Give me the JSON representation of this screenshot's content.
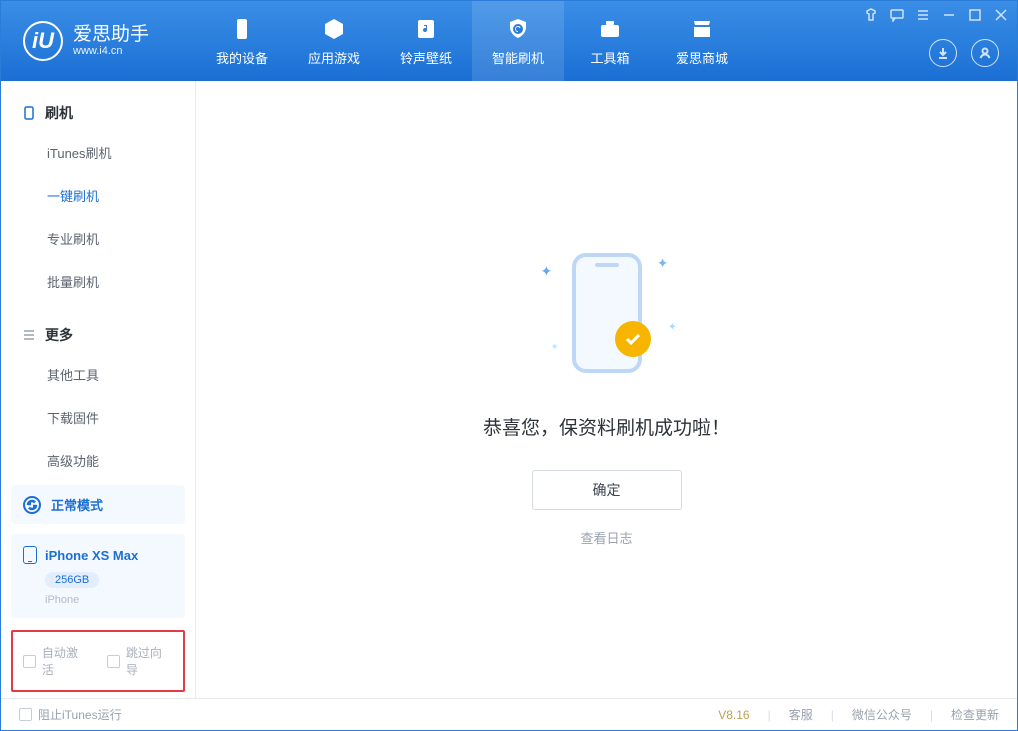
{
  "app": {
    "name": "爱思助手",
    "url": "www.i4.cn"
  },
  "nav": {
    "items": [
      {
        "label": "我的设备"
      },
      {
        "label": "应用游戏"
      },
      {
        "label": "铃声壁纸"
      },
      {
        "label": "智能刷机"
      },
      {
        "label": "工具箱"
      },
      {
        "label": "爱思商城"
      }
    ]
  },
  "sidebar": {
    "section1": {
      "title": "刷机",
      "items": [
        {
          "label": "iTunes刷机"
        },
        {
          "label": "一键刷机"
        },
        {
          "label": "专业刷机"
        },
        {
          "label": "批量刷机"
        }
      ]
    },
    "section2": {
      "title": "更多",
      "items": [
        {
          "label": "其他工具"
        },
        {
          "label": "下载固件"
        },
        {
          "label": "高级功能"
        }
      ]
    },
    "mode_label": "正常模式",
    "device": {
      "name": "iPhone XS Max",
      "storage": "256GB",
      "type": "iPhone"
    },
    "opts": {
      "auto_activate": "自动激活",
      "skip_guide": "跳过向导"
    }
  },
  "main": {
    "success_title": "恭喜您，保资料刷机成功啦！",
    "ok_label": "确定",
    "log_link": "查看日志"
  },
  "footer": {
    "block_itunes": "阻止iTunes运行",
    "version": "V8.16",
    "support": "客服",
    "wechat": "微信公众号",
    "update": "检查更新"
  }
}
